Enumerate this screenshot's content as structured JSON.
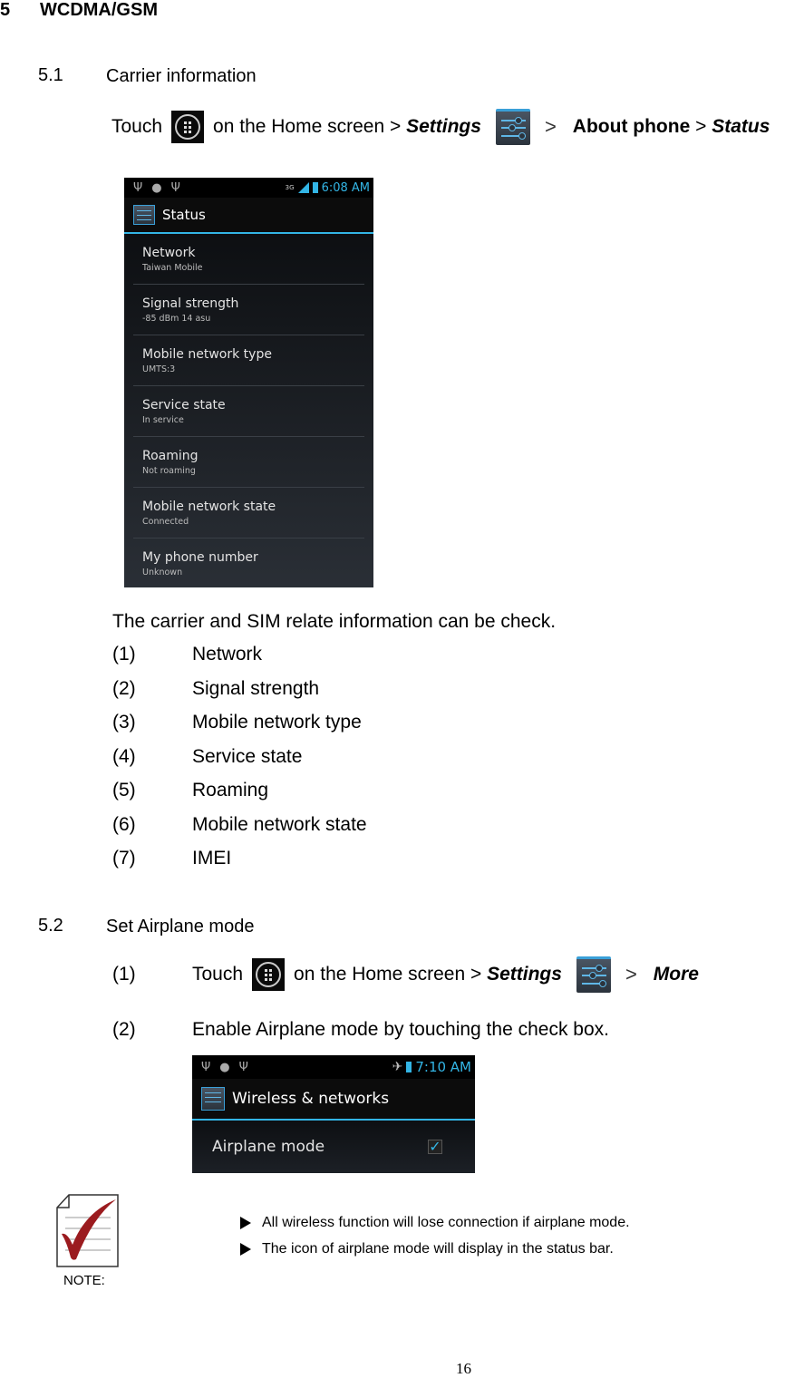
{
  "section": {
    "number": "5",
    "title": "WCDMA/GSM"
  },
  "sub1": {
    "number": "5.1",
    "title": "Carrier information",
    "instruction": {
      "touch": "Touch",
      "apps_icon": "apps-launcher-icon",
      "on_home": "on the Home screen >",
      "settings": "Settings",
      "settings_icon": "settings-icon",
      "sep": ">",
      "about": "About phone",
      "gt": ">",
      "status": "Status"
    },
    "screenshot": {
      "status_bar": {
        "left_icons": [
          "usb-icon",
          "android-debug-icon",
          "usb-icon"
        ],
        "network": "3G",
        "time": "6:08 AM"
      },
      "title": "Status",
      "items": [
        {
          "title": "Network",
          "summary": "Taiwan Mobile"
        },
        {
          "title": "Signal strength",
          "summary": "-85 dBm   14 asu"
        },
        {
          "title": "Mobile network type",
          "summary": "UMTS:3"
        },
        {
          "title": "Service state",
          "summary": "In service"
        },
        {
          "title": "Roaming",
          "summary": "Not roaming"
        },
        {
          "title": "Mobile network state",
          "summary": "Connected"
        },
        {
          "title": "My phone number",
          "summary": "Unknown"
        }
      ]
    },
    "description": "The carrier and SIM relate information can be check.",
    "list": [
      {
        "n": "(1)",
        "v": "Network"
      },
      {
        "n": "(2)",
        "v": "Signal strength"
      },
      {
        "n": "(3)",
        "v": "Mobile network type"
      },
      {
        "n": "(4)",
        "v": "Service state"
      },
      {
        "n": "(5)",
        "v": "Roaming"
      },
      {
        "n": "(6)",
        "v": "Mobile network state"
      },
      {
        "n": "(7)",
        "v": "IMEI"
      }
    ]
  },
  "sub2": {
    "number": "5.2",
    "title": "Set Airplane mode",
    "steps": [
      {
        "n": "(1)",
        "touch": "Touch",
        "on_home": "on the Home screen >",
        "settings": "Settings",
        "sep": ">",
        "more": "More"
      },
      {
        "n": "(2)",
        "text": "Enable Airplane mode by touching the check box."
      }
    ],
    "screenshot": {
      "time": "7:10 AM",
      "title": "Wireless & networks",
      "item": "Airplane mode",
      "checked": true
    }
  },
  "note": {
    "label": "NOTE:",
    "bullets": [
      "All wireless function will lose connection if airplane mode.",
      "The icon of airplane mode will display in the status bar."
    ]
  },
  "page_number": "16",
  "colors": {
    "accent": "#33b5e5",
    "check_red": "#9b1b1f"
  }
}
